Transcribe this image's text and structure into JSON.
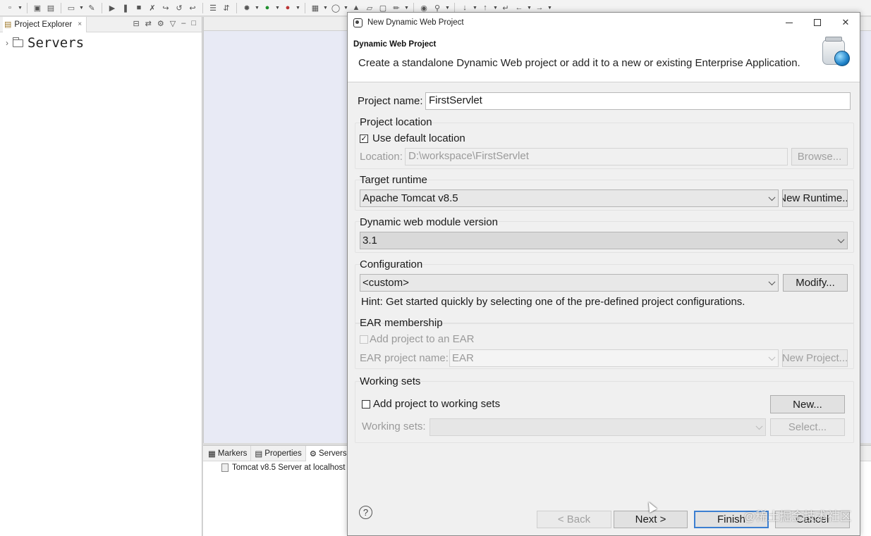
{
  "workbench": {
    "project_explorer": {
      "tab_label": "Project Explorer",
      "tree": [
        {
          "label": "Servers"
        }
      ]
    },
    "bottom_panel": {
      "tabs": [
        "Markers",
        "Properties",
        "Servers"
      ],
      "server_row": "Tomcat v8.5 Server at localhost"
    }
  },
  "dialog": {
    "window_title": "New Dynamic Web Project",
    "header_title": "Dynamic Web Project",
    "header_description": "Create a standalone Dynamic Web project or add it to a new or existing Enterprise Application.",
    "project_name": {
      "label": "Project name:",
      "value": "FirstServlet"
    },
    "project_location": {
      "group_label": "Project location",
      "use_default_label": "Use default location",
      "use_default_checked": true,
      "location_label": "Location:",
      "location_value": "D:\\workspace\\FirstServlet",
      "browse_label": "Browse..."
    },
    "target_runtime": {
      "group_label": "Target runtime",
      "selected": "Apache Tomcat v8.5",
      "new_runtime_label": "New Runtime..."
    },
    "module_version": {
      "group_label": "Dynamic web module version",
      "selected": "3.1"
    },
    "configuration": {
      "group_label": "Configuration",
      "selected": "<custom>",
      "modify_label": "Modify...",
      "hint": "Hint: Get started quickly by selecting one of the pre-defined project configurations."
    },
    "ear_membership": {
      "group_label": "EAR membership",
      "add_label": "Add project to an EAR",
      "add_checked": false,
      "name_label": "EAR project name:",
      "name_value": "EAR",
      "new_project_label": "New Project..."
    },
    "working_sets": {
      "group_label": "Working sets",
      "add_label": "Add project to working sets",
      "add_checked": false,
      "new_label": "New...",
      "sets_label": "Working sets:",
      "select_label": "Select..."
    },
    "buttons": {
      "help": "?",
      "back": "< Back",
      "next": "Next >",
      "finish": "Finish",
      "cancel": "Cancel"
    }
  },
  "watermark": "@稀土掘金技术社区"
}
